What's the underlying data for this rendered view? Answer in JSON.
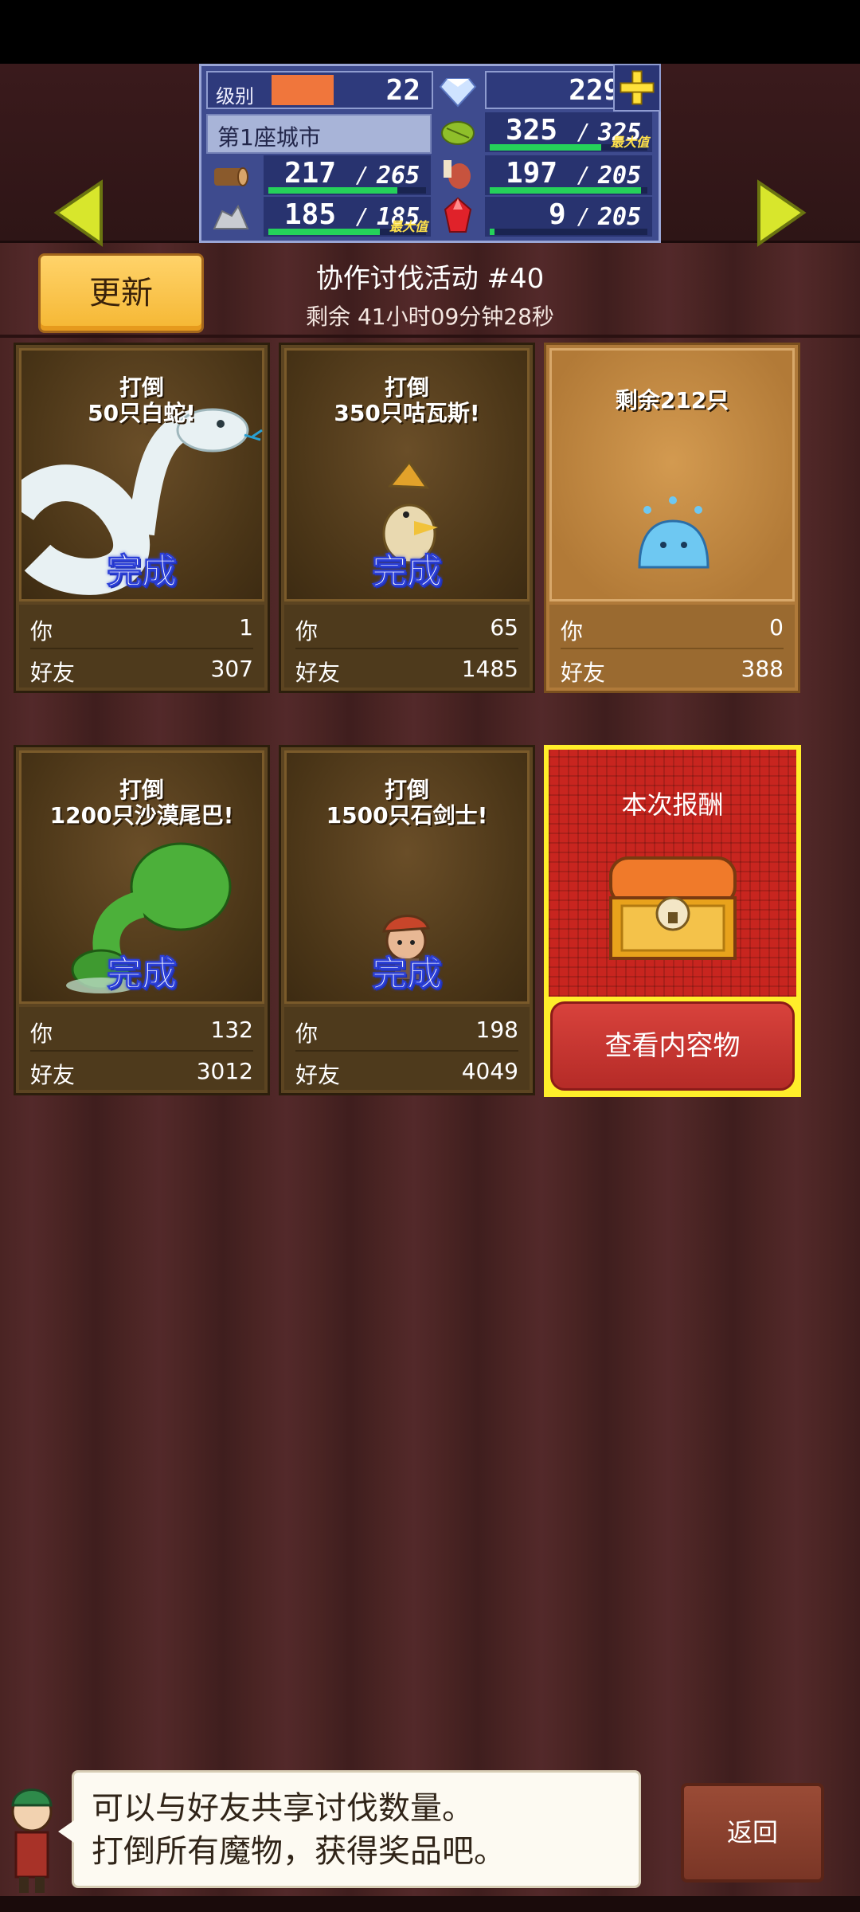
{
  "header": {
    "level_label": "级别",
    "level": "22",
    "gems": "2297",
    "city": "第1座城市",
    "resources": [
      {
        "name": "wood",
        "current": "217",
        "max": "265",
        "fill": 0.82,
        "capped": false
      },
      {
        "name": "crop",
        "current": "325",
        "max": "325",
        "fill": 1.0,
        "capped": true
      },
      {
        "name": "stone",
        "current": "185",
        "max": "185",
        "fill": 1.0,
        "capped": true
      },
      {
        "name": "meat",
        "current": "197",
        "max": "205",
        "fill": 0.96,
        "capped": false
      },
      {
        "name": "crystal",
        "current": "9",
        "max": "205",
        "fill": 0.04,
        "capped": false
      }
    ],
    "max_label": "最大值"
  },
  "event": {
    "refresh_label": "更新",
    "title": "协作讨伐活动 #40",
    "time_left": "剩余 41小时09分钟28秒"
  },
  "cards": [
    {
      "goal_line1": "打倒",
      "goal_line2": "50只白蛇!",
      "status": "完成",
      "you_label": "你",
      "you": "1",
      "friends_label": "好友",
      "friends": "307",
      "monster": "white-snake"
    },
    {
      "goal_line1": "打倒",
      "goal_line2": "350只咕瓦斯!",
      "status": "完成",
      "you_label": "你",
      "you": "65",
      "friends_label": "好友",
      "friends": "1485",
      "monster": "bird"
    },
    {
      "goal_line1": "剩余212只",
      "goal_line2": "",
      "status": "",
      "you_label": "你",
      "you": "0",
      "friends_label": "好友",
      "friends": "388",
      "monster": "slime"
    },
    {
      "goal_line1": "打倒",
      "goal_line2": "1200只沙漠尾巴!",
      "status": "完成",
      "you_label": "你",
      "you": "132",
      "friends_label": "好友",
      "friends": "3012",
      "monster": "desert-tail"
    },
    {
      "goal_line1": "打倒",
      "goal_line2": "1500只石剑士!",
      "status": "完成",
      "you_label": "你",
      "you": "198",
      "friends_label": "好友",
      "friends": "4049",
      "monster": "stone-swordsman"
    }
  ],
  "reward": {
    "title": "本次报酬",
    "view_label": "查看内容物"
  },
  "dialog": {
    "line1": "可以与好友共享讨伐数量。",
    "line2": "打倒所有魔物，获得奖品吧。"
  },
  "back_label": "返回",
  "colors": {
    "accent_green": "#25d15a",
    "level_bar": "#f0763c",
    "done_blue": "#2b3fd8",
    "reward_red": "#c8251f",
    "refresh_yellow": "#f5b733"
  }
}
